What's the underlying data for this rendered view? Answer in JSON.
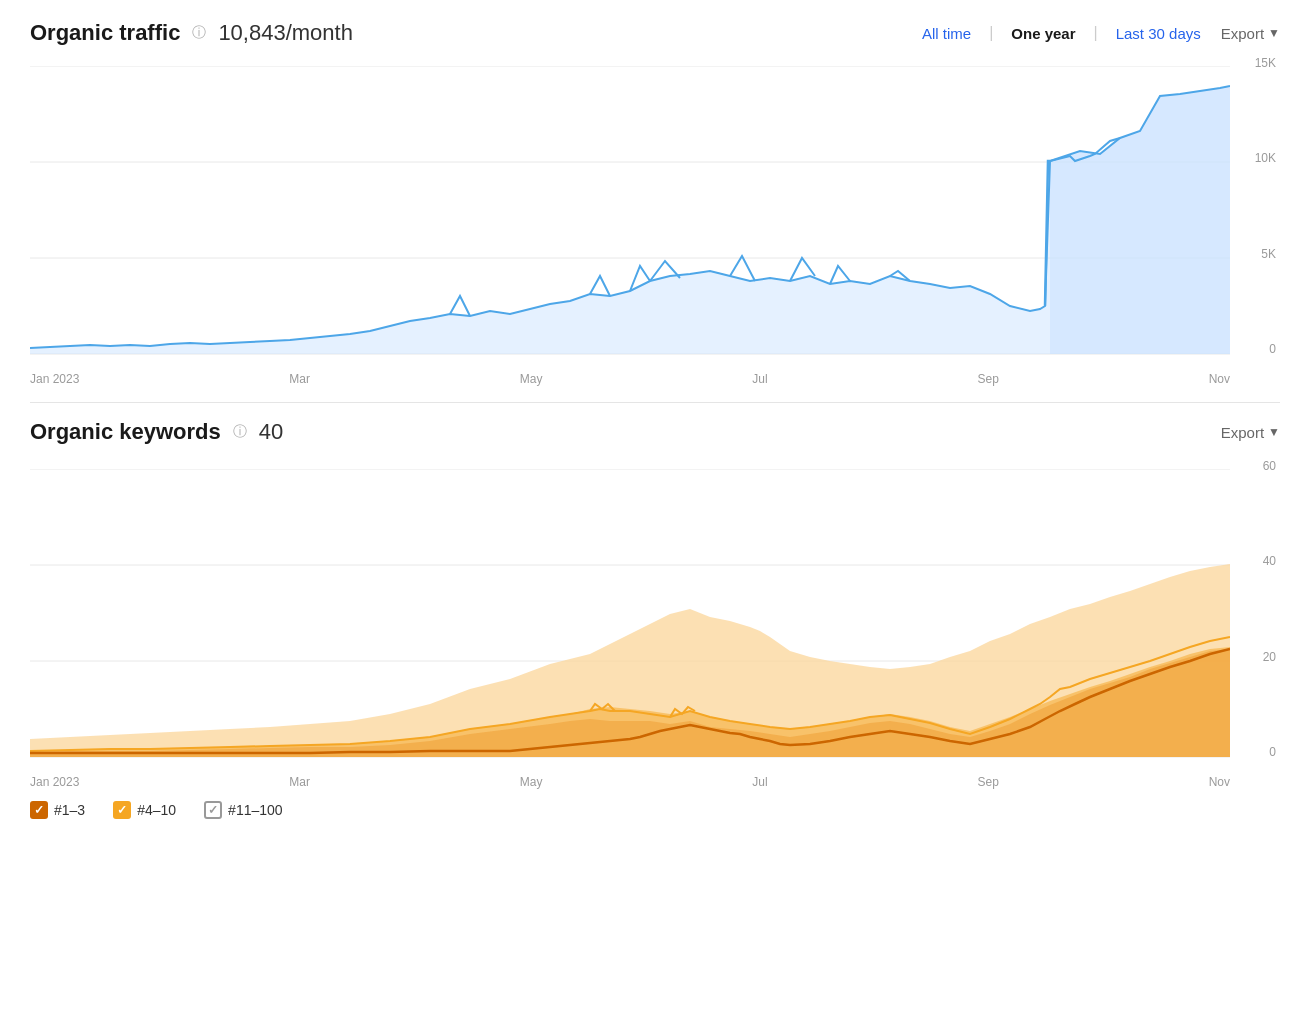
{
  "organic_traffic": {
    "title": "Organic traffic",
    "value": "10,843",
    "unit": "/month",
    "info_icon": "ⓘ"
  },
  "time_filters": {
    "all_time": "All time",
    "one_year": "One year",
    "last_30_days": "Last 30 days",
    "active": "one_year"
  },
  "export_label": "Export",
  "traffic_chart": {
    "y_labels": [
      "15K",
      "10K",
      "5K",
      "0"
    ],
    "x_labels": [
      "Jan 2023",
      "Mar",
      "May",
      "Jul",
      "Sep",
      "Nov"
    ],
    "description": "Organic traffic over one year"
  },
  "organic_keywords": {
    "title": "Organic keywords",
    "value": "40",
    "info_icon": "ⓘ"
  },
  "keywords_chart": {
    "y_labels": [
      "60",
      "40",
      "20",
      "0"
    ],
    "x_labels": [
      "Jan 2023",
      "Mar",
      "May",
      "Jul",
      "Sep",
      "Nov"
    ],
    "description": "Organic keywords by rank group over one year"
  },
  "legend": {
    "items": [
      {
        "label": "#1–3",
        "color": "dark-orange",
        "check": "✓"
      },
      {
        "label": "#4–10",
        "color": "orange",
        "check": "✓"
      },
      {
        "label": "#11–100",
        "color": "light",
        "check": "✓"
      }
    ]
  }
}
